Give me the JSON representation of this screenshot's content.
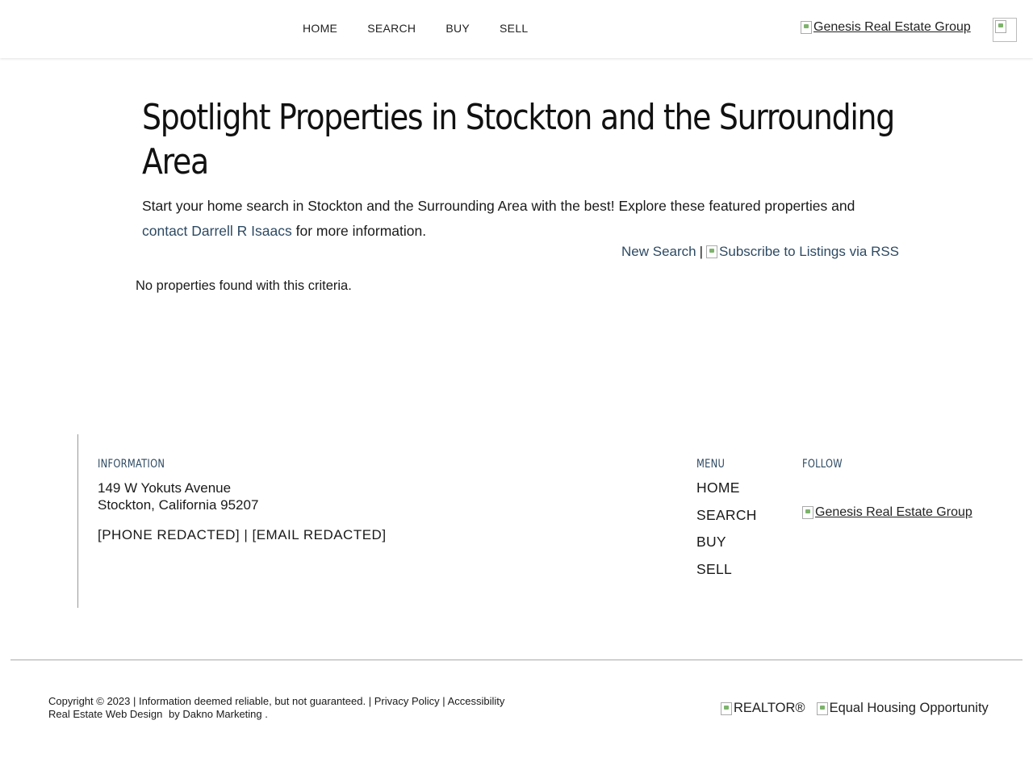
{
  "header": {
    "nav": [
      "HOME",
      "SEARCH",
      "BUY",
      "SELL"
    ],
    "logo_alt": "Genesis Real Estate Group"
  },
  "main": {
    "title": "Spotlight Properties in Stockton and the Surrounding Area",
    "intro_before": "Start your home search in Stockton and the Surrounding Area with the best! Explore these featured properties and ",
    "intro_link": "contact Darrell R Isaacs",
    "intro_after": " for more information.",
    "new_search": "New Search",
    "separator": "|",
    "rss_alt": "Subscribe to Listings via RSS",
    "no_results": "No properties found with this criteria."
  },
  "footer": {
    "info_heading": "INFORMATION",
    "address_line1": "149 W Yokuts Avenue",
    "address_line2": "Stockton, California 95207",
    "contact": "[PHONE REDACTED] | [EMAIL REDACTED]",
    "menu_heading": "MENU",
    "menu": [
      "HOME",
      "SEARCH",
      "BUY",
      "SELL"
    ],
    "follow_heading": "FOLLOW",
    "follow_logo_alt": "Genesis Real Estate Group",
    "copyright": "Copyright © 2023 | Information deemed reliable, but not guaranteed. |",
    "privacy": "Privacy Policy",
    "pipe": "|",
    "accessibility": "Accessibility",
    "web_design": "Real Estate Web Design",
    "by": "by",
    "dakno": "Dakno Marketing",
    "period": ".",
    "realtor_alt": "REALTOR®",
    "eho_alt": "Equal Housing Opportunity"
  }
}
